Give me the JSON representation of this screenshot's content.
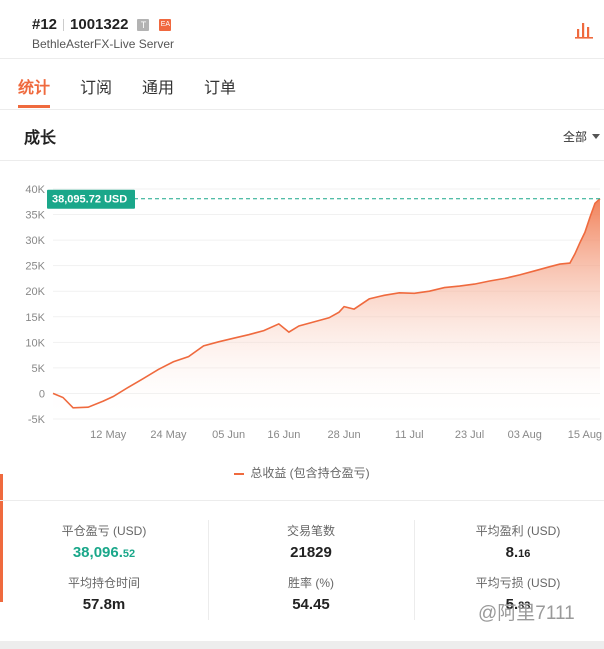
{
  "header": {
    "rank": "#12",
    "account_id": "1001322",
    "badge_t": "T",
    "badge_ea": "EA",
    "server": "BethleAsterFX-Live Server"
  },
  "tabs": [
    "统计",
    "订阅",
    "通用",
    "订单"
  ],
  "section": {
    "title": "成长",
    "range": "全部"
  },
  "chart_data": {
    "type": "area",
    "series": [
      {
        "name": "总收益 (包含持仓盈亏)",
        "x": [
          "05-01",
          "05-03",
          "05-05",
          "05-08",
          "05-11",
          "05-13",
          "05-16",
          "05-19",
          "05-22",
          "05-25",
          "05-28",
          "05-31",
          "06-03",
          "06-06",
          "06-09",
          "06-12",
          "06-15",
          "06-17",
          "06-19",
          "06-22",
          "06-25",
          "06-27",
          "06-28",
          "06-30",
          "07-03",
          "07-06",
          "07-09",
          "07-12",
          "07-15",
          "07-18",
          "07-21",
          "07-24",
          "07-27",
          "07-30",
          "08-02",
          "08-05",
          "08-08",
          "08-10",
          "08-12",
          "08-13",
          "08-14",
          "08-15",
          "08-16",
          "08-17",
          "08-18"
        ],
        "values": [
          0,
          -800,
          -2800,
          -2700,
          -1500,
          -600,
          1200,
          2900,
          4700,
          6200,
          7200,
          9300,
          10100,
          10800,
          11500,
          12300,
          13600,
          12000,
          13200,
          14000,
          14800,
          15900,
          17000,
          16500,
          18500,
          19200,
          19700,
          19600,
          20000,
          20700,
          21000,
          21400,
          22000,
          22500,
          23200,
          24000,
          24800,
          25300,
          25500,
          27300,
          29500,
          31500,
          34500,
          37200,
          38096
        ]
      }
    ],
    "x_ticks": [
      "12 May",
      "24 May",
      "05 Jun",
      "16 Jun",
      "28 Jun",
      "11 Jul",
      "23 Jul",
      "03 Aug",
      "15 Aug"
    ],
    "x_tick_dates": [
      "05-12",
      "05-24",
      "06-05",
      "06-16",
      "06-28",
      "07-11",
      "07-23",
      "08-03",
      "08-15"
    ],
    "y_ticks": [
      "-5K",
      "0",
      "5K",
      "10K",
      "15K",
      "20K",
      "25K",
      "30K",
      "35K",
      "40K"
    ],
    "ylim": [
      -5000,
      40000
    ],
    "last_value_label": "38,095.72 USD",
    "colors": {
      "line": "#ef6a3e",
      "label_bg": "#1aa78a",
      "guide": "#1aa78a"
    },
    "legend_position": "bottom"
  },
  "legend": {
    "label": "总收益 (包含持仓盈亏)"
  },
  "stats": [
    {
      "label": "平仓盈亏 (USD)",
      "value_main": "38,096.",
      "value_frac": "52",
      "color": "#1aa78a"
    },
    {
      "label": "交易笔数",
      "value_main": "21829",
      "value_frac": ""
    },
    {
      "label": "平均盈利 (USD)",
      "value_main": "8.",
      "value_frac": "16"
    },
    {
      "label": "平均持仓时间",
      "value_main": "57.8m",
      "value_frac": ""
    },
    {
      "label": "胜率 (%)",
      "value_main": "54.45",
      "value_frac": ""
    },
    {
      "label": "平均亏损 (USD)",
      "value_main": "5.",
      "value_frac": "83"
    }
  ],
  "watermark": "@阿里7111"
}
